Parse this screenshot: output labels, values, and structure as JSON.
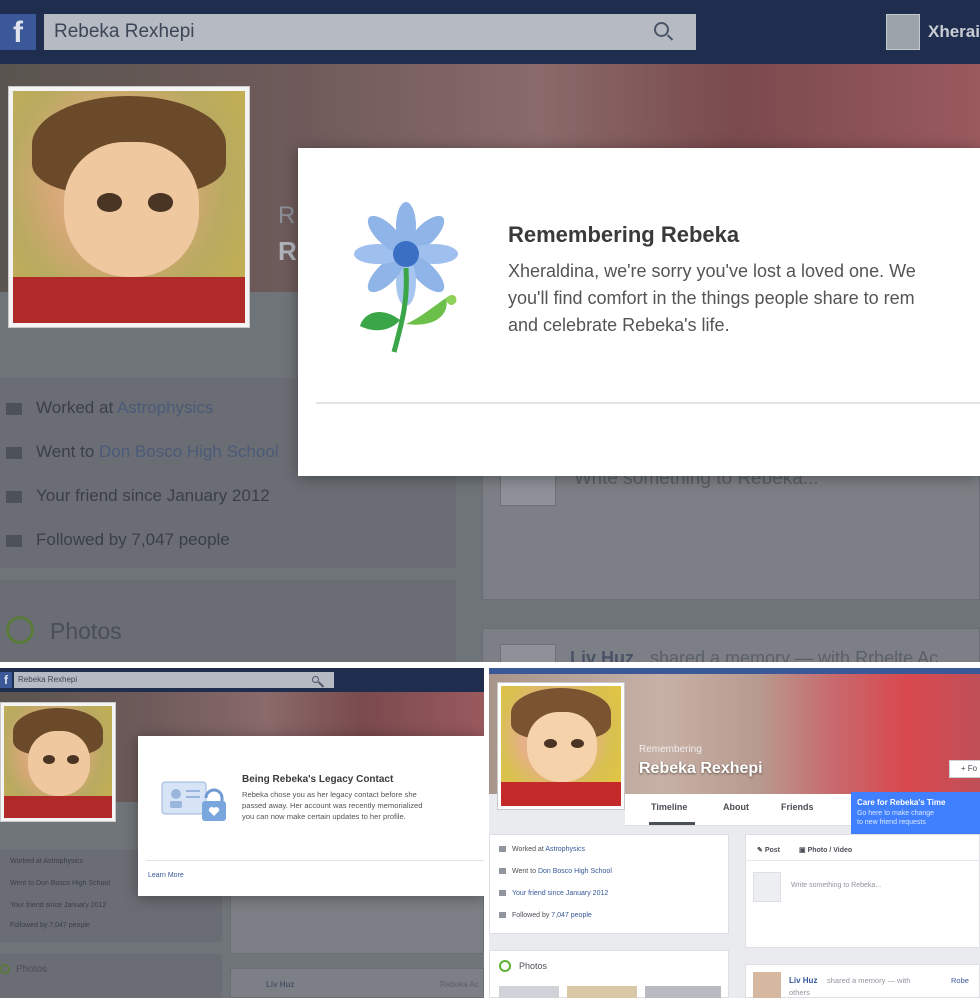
{
  "main": {
    "search_value": "Rebeka Rexhepi",
    "user_short": "Xherai",
    "cover_initial": "R",
    "info": [
      {
        "icon": "briefcase-icon",
        "prefix": "Worked at ",
        "link": "Astrophysics"
      },
      {
        "icon": "graduation-icon",
        "prefix": "Went to ",
        "link": "Don Bosco High School"
      },
      {
        "icon": "friend-icon",
        "prefix": "Your friend since January 2012",
        "link": ""
      },
      {
        "icon": "rss-icon",
        "prefix": "Followed by 7,047 people",
        "link": ""
      }
    ],
    "photos_label": "Photos",
    "composer_placeholder": "Write something to Rebeka...",
    "feed_name": "Liv Huz",
    "feed_rest": "shared a memory — with Rrbelte Ac"
  },
  "memorial_modal": {
    "title": "Remembering Rebeka",
    "body": "Xheraldina, we're sorry you've lost a loved one. We\nyou'll find comfort in the things people share to rem\nand celebrate Rebeka's life."
  },
  "legacy": {
    "search_value": "Rebeka Rexhepi",
    "modal_title": "Being Rebeka's Legacy Contact",
    "modal_body": "Rebeka chose you as her legacy contact before she\npassed away. Her account was recently memorialized\nyou can now make certain updates to her profile.",
    "learn_more": "Learn More",
    "info": [
      "Worked at Astrophysics",
      "Went to Don Bosco High School",
      "Your friend since January 2012",
      "Followed by 7,047 people"
    ],
    "photos_label": "Photos",
    "feed_name": "Liv Huz",
    "feed_rest": "Rebeka Ac"
  },
  "profile": {
    "remembering": "Remembering",
    "name": "Rebeka Rexhepi",
    "tabs": [
      "Timeline",
      "About",
      "Friends"
    ],
    "follow_label": "+ Fo",
    "tooltip_title": "Care for Rebeka's Time",
    "tooltip_body": "Go here to make change\nto new friend requests",
    "info": [
      {
        "prefix": "Worked at ",
        "link": "Astrophysics"
      },
      {
        "prefix": "Went to ",
        "link": "Don Bosco High School"
      },
      {
        "prefix": "",
        "link": "Your friend since January 2012"
      },
      {
        "prefix": "Followed by ",
        "link": "7,047 people"
      }
    ],
    "post_tab": "Post",
    "photo_video_tab": "Photo / Video",
    "composer_placeholder": "Write something to Rebeka...",
    "photos_label": "Photos",
    "feed_name": "Liv Huz",
    "feed_rest": "shared a memory — with",
    "feed_rest2": "Robe",
    "feed_others": "others"
  },
  "colors": {
    "facebook_blue": "#3b5998",
    "link_blue": "#365899",
    "tooltip_blue": "#4080ff",
    "flower_petal": "#8fb4e8",
    "flower_center": "#3a6fc4",
    "flower_leaf": "#3aa648"
  }
}
